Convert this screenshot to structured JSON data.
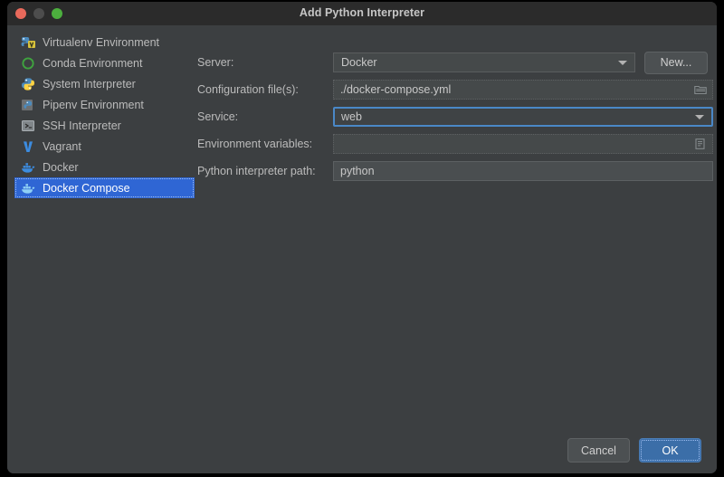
{
  "window": {
    "title": "Add Python Interpreter",
    "traffic_lights": [
      {
        "name": "close",
        "color": "#e8695b"
      },
      {
        "name": "minimize",
        "color": "#4d4d4d"
      },
      {
        "name": "zoom",
        "color": "#4caf3e"
      }
    ]
  },
  "sidebar": {
    "items": [
      {
        "label": "Virtualenv Environment",
        "icon": "virtualenv-icon",
        "selected": false
      },
      {
        "label": "Conda Environment",
        "icon": "conda-icon",
        "selected": false
      },
      {
        "label": "System Interpreter",
        "icon": "python-icon",
        "selected": false
      },
      {
        "label": "Pipenv Environment",
        "icon": "pipenv-icon",
        "selected": false
      },
      {
        "label": "SSH Interpreter",
        "icon": "ssh-terminal-icon",
        "selected": false
      },
      {
        "label": "Vagrant",
        "icon": "vagrant-icon",
        "selected": false
      },
      {
        "label": "Docker",
        "icon": "docker-whale-icon",
        "selected": false
      },
      {
        "label": "Docker Compose",
        "icon": "docker-compose-icon",
        "selected": true
      }
    ]
  },
  "form": {
    "server": {
      "label": "Server:",
      "value": "Docker",
      "new_button": "New..."
    },
    "config_files": {
      "label": "Configuration file(s):",
      "value": "./docker-compose.yml",
      "icon": "folder-icon"
    },
    "service": {
      "label": "Service:",
      "value": "web",
      "focused": true
    },
    "env_vars": {
      "label": "Environment variables:",
      "value": "",
      "placeholder": "",
      "icon": "list-edit-icon"
    },
    "interpreter_path": {
      "label": "Python interpreter path:",
      "value": "python"
    }
  },
  "footer": {
    "cancel_label": "Cancel",
    "ok_label": "OK"
  },
  "colors": {
    "window_bg": "#3c3f41",
    "titlebar_bg": "#2b2b2b",
    "selection_blue": "#2f66d4",
    "focus_blue": "#4a88c7",
    "ok_button_blue": "#3b6ea8"
  }
}
